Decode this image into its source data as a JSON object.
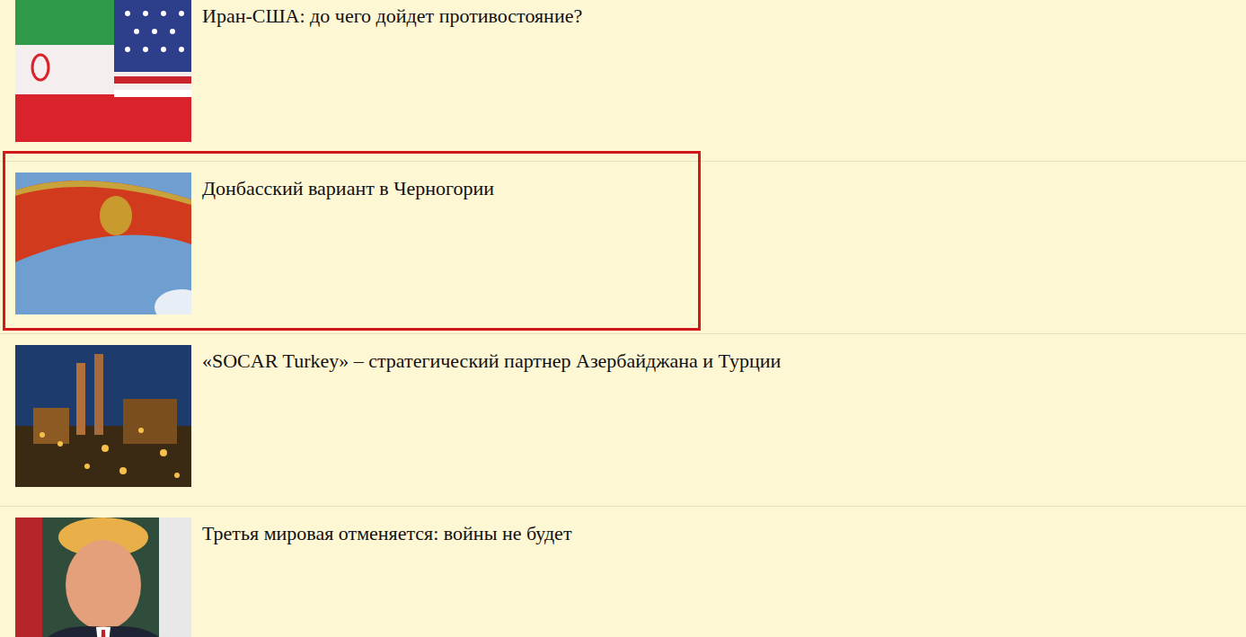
{
  "articles": [
    {
      "title": "Иран-США: до чего дойдет противостояние?",
      "highlighted": false
    },
    {
      "title": "Донбасский вариант в Черногории",
      "highlighted": true
    },
    {
      "title": "«SOCAR Turkey» – стратегический партнер Азербайджана и Турции",
      "highlighted": false
    },
    {
      "title": "Третья мировая отменяется: войны не будет",
      "highlighted": false
    }
  ]
}
